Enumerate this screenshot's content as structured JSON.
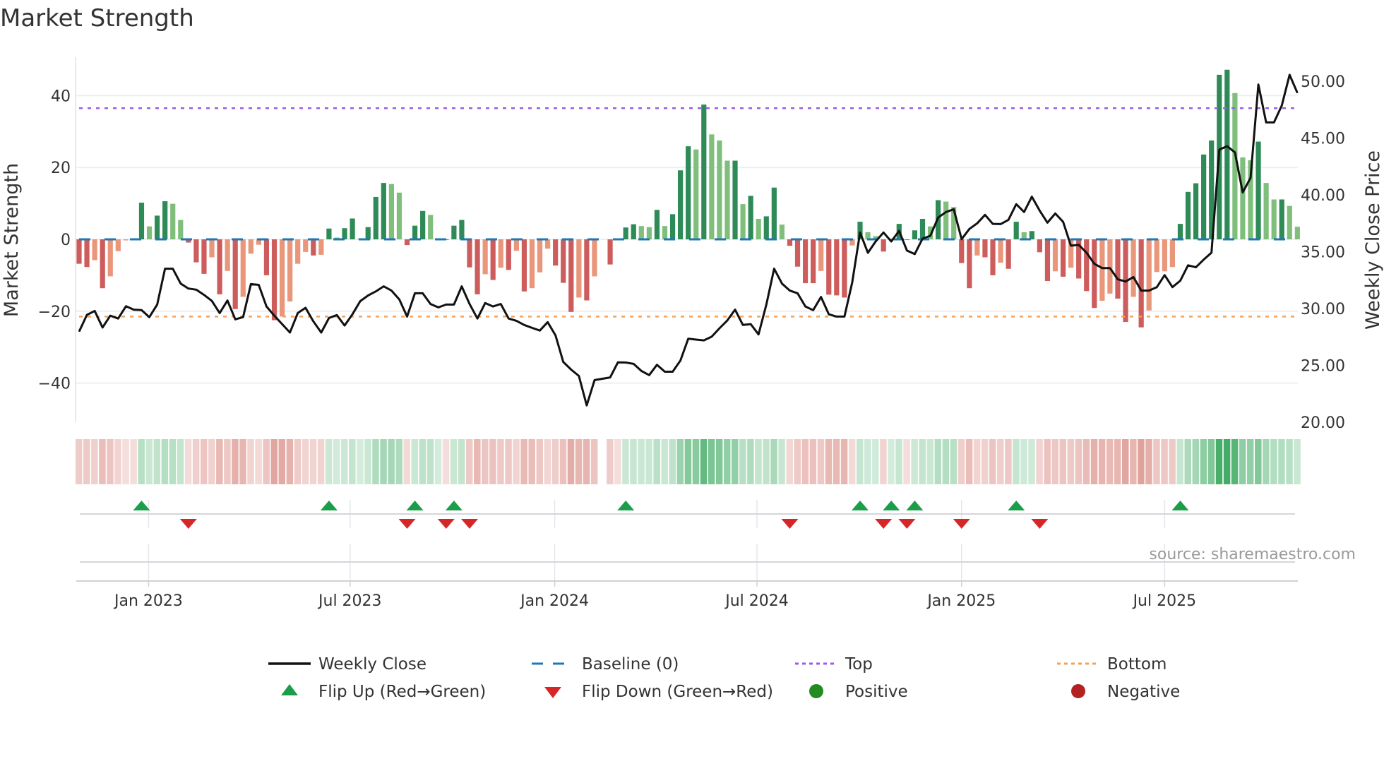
{
  "title": "Market Strength",
  "source": "source: sharemaestro.com",
  "legend": [
    {
      "key": "close",
      "label": "Weekly Close"
    },
    {
      "key": "baseline",
      "label": "Baseline (0)"
    },
    {
      "key": "top",
      "label": "Top"
    },
    {
      "key": "bottom",
      "label": "Bottom"
    },
    {
      "key": "flip_up",
      "label": "Flip Up (Red→Green)"
    },
    {
      "key": "flip_down",
      "label": "Flip Down (Green→Red)"
    },
    {
      "key": "positive",
      "label": "Positive"
    },
    {
      "key": "negative",
      "label": "Negative"
    }
  ],
  "colors": {
    "pos_strong": "#2e8b57",
    "pos_weak": "#7fbf7b",
    "neg_strong": "#cd5c5c",
    "neg_weak": "#e9967a",
    "baseline": "#1f77b4",
    "top": "#9b5de5",
    "bottom": "#f4a259",
    "flip_up": "#1a9e4a",
    "flip_down": "#d62728",
    "positive": "#228b22",
    "negative": "#b22222",
    "close": "#111111"
  },
  "chart_data": {
    "type": "bar+line",
    "title": "Market Strength",
    "ylabel": "Market Strength",
    "y2label": "Weekly Close Price",
    "ylim": [
      -52,
      51
    ],
    "y2lim": [
      20,
      52.2
    ],
    "yticks": [
      {
        "v": 40,
        "label": "40"
      },
      {
        "v": 20,
        "label": "20"
      },
      {
        "v": 0,
        "label": "0"
      },
      {
        "v": -20,
        "label": "−20"
      },
      {
        "v": -40,
        "label": "−40"
      }
    ],
    "y2ticks": [
      {
        "v": 50,
        "label": "50.00"
      },
      {
        "v": 45,
        "label": "45.00"
      },
      {
        "v": 40,
        "label": "40.00"
      },
      {
        "v": 35,
        "label": "35.00"
      },
      {
        "v": 30,
        "label": "30.00"
      },
      {
        "v": 25,
        "label": "25.00"
      },
      {
        "v": 20,
        "label": "20.00"
      }
    ],
    "xticks": [
      {
        "week": 8.9,
        "label": "Jan 2023"
      },
      {
        "week": 34.7,
        "label": "Jul 2023"
      },
      {
        "week": 60.9,
        "label": "Jan 2024"
      },
      {
        "week": 86.8,
        "label": "Jul 2024"
      },
      {
        "week": 113.0,
        "label": "Jan 2025"
      },
      {
        "week": 139.0,
        "label": "Jul 2025"
      }
    ],
    "top_level": 36.5,
    "bottom_level": -21.5,
    "baseline": 0,
    "strength": [
      -6.8,
      -7.7,
      -5.8,
      -13.6,
      -10.3,
      -3.3,
      -0.3,
      -0.2,
      10.2,
      3.6,
      6.6,
      10.6,
      9.9,
      5.4,
      -0.9,
      -6.4,
      -9.6,
      -5,
      -15.3,
      -8.8,
      -19.4,
      -16,
      -4,
      -1.5,
      -10,
      -22.5,
      -21.5,
      -17.3,
      -6.8,
      -3.5,
      -4.5,
      -4.3,
      3,
      0.5,
      3.1,
      5.8,
      0.2,
      3.4,
      11.8,
      15.7,
      15.4,
      13,
      -1.6,
      3.8,
      7.9,
      6.8,
      0.2,
      -0.2,
      3.8,
      5.4,
      -7.8,
      -15.3,
      -9.7,
      -11.3,
      -7.9,
      -8.5,
      -3.2,
      -14.5,
      -13.6,
      -9.2,
      -2.6,
      -7.3,
      -12.1,
      -20.2,
      -16.2,
      -17,
      -10.3,
      null,
      -7,
      -0.2,
      3.3,
      4.2,
      3.7,
      3.4,
      8.2,
      3.7,
      7,
      19.2,
      25.9,
      25,
      37.5,
      29.2,
      27.5,
      21.9,
      21.9,
      9.8,
      12.1,
      5.7,
      6.4,
      14.4,
      4.1,
      -1.8,
      -7.6,
      -12.2,
      -12.2,
      -8.8,
      -15.4,
      -15.6,
      -16.2,
      -1.7,
      4.9,
      2,
      0.9,
      -3.4,
      0.2,
      4.3,
      -0.2,
      2.5,
      5.7,
      3.6,
      10.9,
      10.5,
      9,
      -6.6,
      -13.6,
      -4.5,
      -5,
      -10,
      -6.5,
      -8.2,
      4.9,
      2,
      2.3,
      -3.6,
      -11.6,
      -8.9,
      -10.4,
      -7.9,
      -10.9,
      -14.4,
      -19.1,
      -17.1,
      -15.1,
      -16.5,
      -23,
      -16,
      -24.5,
      -19.8,
      -9.1,
      -8.9,
      -7.7,
      4.3,
      13.2,
      15.6,
      23.6,
      27.5,
      45.8,
      47.2,
      40.7,
      22.8,
      22,
      27.2,
      15.7,
      11.1,
      11.1,
      9.3,
      3.5
    ],
    "close": [
      27.96,
      29.44,
      29.79,
      28.33,
      29.37,
      29.12,
      30.2,
      29.9,
      29.86,
      29.24,
      30.35,
      33.5,
      33.5,
      32.2,
      31.76,
      31.66,
      31.2,
      30.67,
      29.6,
      30.7,
      29.05,
      29.24,
      32.15,
      32.08,
      30.18,
      29.37,
      28.63,
      27.89,
      29.6,
      30.06,
      28.87,
      27.89,
      29.17,
      29.42,
      28.5,
      29.49,
      30.65,
      31.14,
      31.51,
      31.95,
      31.58,
      30.8,
      29.29,
      31.34,
      31.34,
      30.4,
      30.1,
      30.35,
      30.35,
      31.95,
      30.4,
      29.12,
      30.48,
      30.18,
      30.4,
      29.12,
      28.92,
      28.55,
      28.3,
      28.06,
      28.8,
      27.64,
      25.3,
      24.63,
      24.07,
      21.48,
      23.7,
      23.82,
      23.94,
      25.27,
      25.25,
      25.13,
      24.51,
      24.14,
      25.05,
      24.44,
      24.44,
      25.42,
      27.35,
      27.27,
      27.2,
      27.52,
      28.26,
      28.95,
      29.9,
      28.55,
      28.63,
      27.72,
      30.35,
      33.5,
      32.2,
      31.58,
      31.34,
      30.18,
      29.86,
      31.02,
      29.49,
      29.29,
      29.29,
      32.3,
      36.69,
      34.9,
      35.9,
      36.69,
      35.9,
      36.83,
      35.1,
      34.79,
      36.15,
      36.4,
      38.0,
      38.49,
      38.73,
      36.1,
      37.0,
      37.5,
      38.24,
      37.45,
      37.43,
      37.8,
      39.18,
      38.49,
      39.84,
      38.61,
      37.55,
      38.36,
      37.62,
      35.53,
      35.6,
      34.91,
      33.93,
      33.56,
      33.56,
      32.57,
      32.37,
      32.77,
      31.58,
      31.58,
      31.88,
      32.94,
      31.88,
      32.45,
      33.8,
      33.63,
      34.3,
      34.91,
      43.98,
      44.28,
      43.74,
      40.21,
      41.49,
      49.7,
      46.37,
      46.37,
      47.85,
      50.56,
      48.96
    ],
    "legend_placement": "bottom",
    "grid": true
  }
}
